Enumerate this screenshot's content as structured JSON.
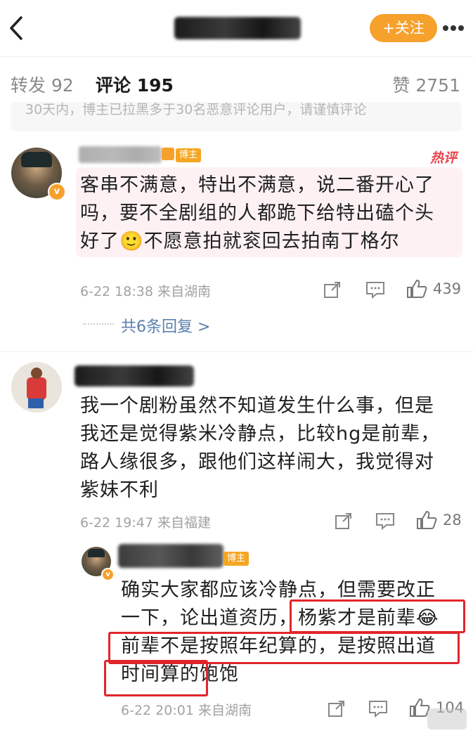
{
  "header": {
    "back_icon": "chevron-left-icon",
    "follow_button": "+关注",
    "more_icon": "more-dots-icon"
  },
  "tabs": {
    "repost": "转发 92",
    "comments": "评论 195",
    "likes": "赞 2751"
  },
  "notice": "30天内，博主已拉黑多于30名恶意评论用户，请谨慎评论",
  "comments": [
    {
      "badge": "博主",
      "hot_label": "热评",
      "text_lines": [
        "客串不满意，特出不满意，说二番开心了",
        "吗，要不全剧组的人都跪下给特出磕个头",
        "好了🙂不愿意拍就衮回去拍南丁格尔"
      ],
      "time": "6-22 18:38 来自湖南",
      "likes": "439",
      "replies_link": "共6条回复 >"
    },
    {
      "text_lines": [
        "我一个剧粉虽然不知道发生什么事，但是",
        "我还是觉得紫米冷静点，比较hg是前辈，",
        "路人缘很多，跟他们这样闹大，我觉得对",
        "紫妹不利"
      ],
      "time": "6-22 19:47 来自福建",
      "likes": "28"
    }
  ],
  "reply": {
    "badge": "博主",
    "text_line1": "确实大家都应该冷静点，但需要改正",
    "text_line2_a": "一下，论出道资历，",
    "text_line2_b": "杨紫才是前辈😂",
    "text_line3": "前辈不是按照年纪算的，是按照出道",
    "text_line4_a": "时间算的",
    "text_line4_b": "饱饱",
    "time": "6-22 20:01 来自湖南",
    "likes": "104"
  },
  "colors": {
    "accent_orange": "#f6a12c",
    "red_box": "#e0262b",
    "hot_pink": "#fdf1f3"
  }
}
